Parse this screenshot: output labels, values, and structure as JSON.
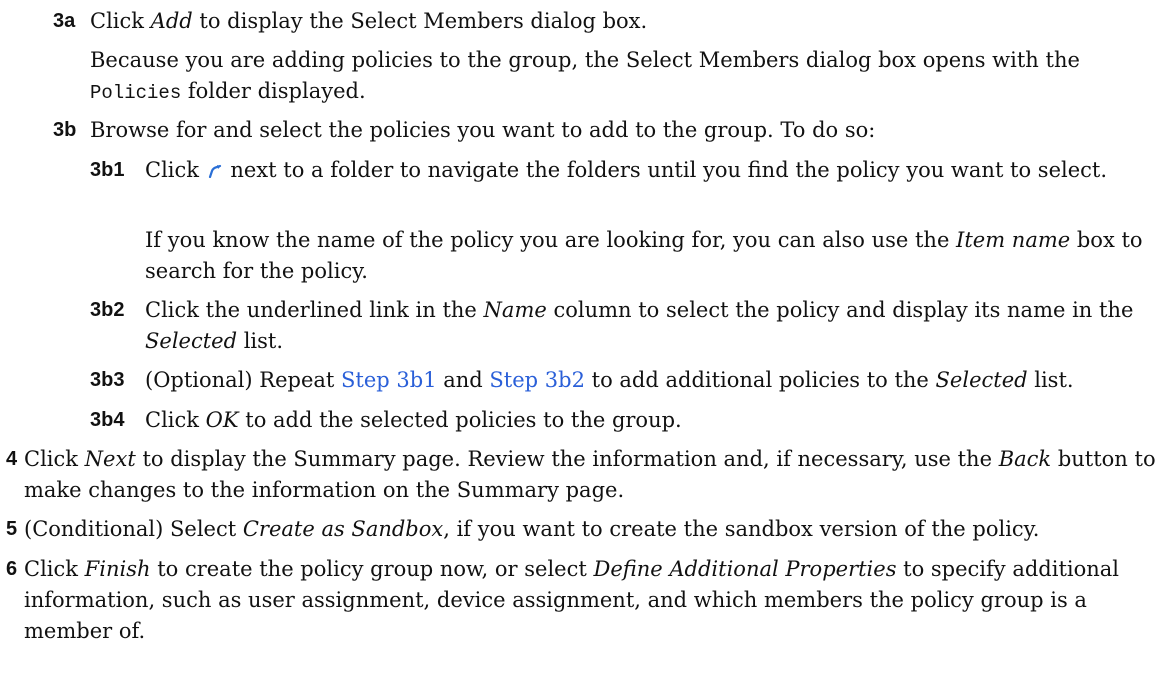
{
  "steps": {
    "s3a": {
      "num": "3a",
      "p1_a": "Click ",
      "p1_em": "Add",
      "p1_b": " to display the Select Members dialog box.",
      "p2_a": "Because you are adding policies to the group, the Select Members dialog box opens with the ",
      "p2_code": "Policies",
      "p2_b": " folder displayed."
    },
    "s3b": {
      "num": "3b",
      "text": "Browse for and select the policies you want to add to the group. To do so:"
    },
    "s3b1": {
      "num": "3b1",
      "p1_a": "Click ",
      "p1_b": " next to a folder to navigate the folders until you find the policy you want to select.",
      "p2_a": "If you know the name of the policy you are looking for, you can also use the ",
      "p2_em": "Item name",
      "p2_b": " box to search for the policy."
    },
    "s3b2": {
      "num": "3b2",
      "a": "Click the underlined link in the ",
      "em1": "Name",
      "b": " column to select the policy and display its name in the ",
      "em2": "Selected",
      "c": " list."
    },
    "s3b3": {
      "num": "3b3",
      "a": "(Optional) Repeat ",
      "link1": "Step 3b1",
      "b": " and ",
      "link2": "Step 3b2",
      "c": " to add additional policies to the ",
      "em": "Selected",
      "d": " list."
    },
    "s3b4": {
      "num": "3b4",
      "a": "Click ",
      "em": "OK",
      "b": " to add the selected policies to the group."
    },
    "s4": {
      "num": "4",
      "a": "Click ",
      "em1": "Next",
      "b": " to display the Summary page. Review the information and, if necessary, use the ",
      "em2": "Back",
      "c": " button to make changes to the information on the Summary page."
    },
    "s5": {
      "num": "5",
      "a": "(Conditional) Select ",
      "em": "Create as Sandbox",
      "b": ", if you want to create the sandbox version of the policy."
    },
    "s6": {
      "num": "6",
      "a": "Click ",
      "em1": "Finish",
      "b": " to create the policy group now, or select ",
      "em2": "Define Additional Properties",
      "c": " to specify additional information, such as user assignment, device assignment, and which members the policy group is a member of."
    }
  },
  "colors": {
    "link": "#2a5fd8",
    "icon": "#2a6fd6"
  },
  "icons": {
    "navigate": "folder-navigate-arrow-icon"
  }
}
